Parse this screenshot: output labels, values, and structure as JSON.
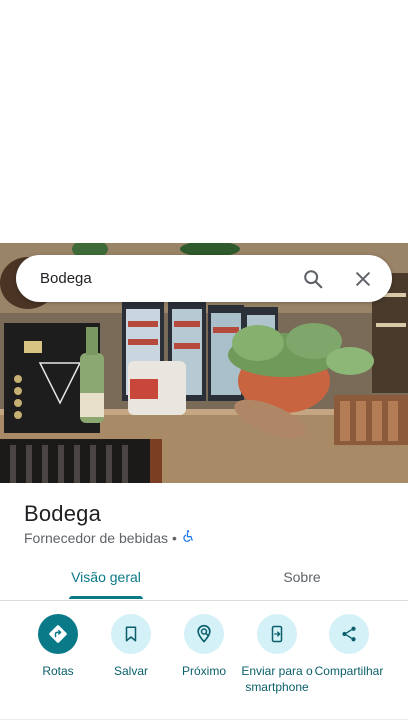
{
  "search": {
    "query": "Bodega"
  },
  "place": {
    "name": "Bodega",
    "category": "Fornecedor de bebidas",
    "separator": "•",
    "accessibility_icon": "wheelchair-icon"
  },
  "tabs": [
    {
      "label": "Visão geral",
      "selected": true
    },
    {
      "label": "Sobre",
      "selected": false
    }
  ],
  "actions": [
    {
      "label": "Rotas",
      "icon": "directions-icon"
    },
    {
      "label": "Salvar",
      "icon": "bookmark-icon"
    },
    {
      "label": "Próximo",
      "icon": "nearby-icon"
    },
    {
      "label": "Enviar para o smartphone",
      "icon": "send-to-phone-icon"
    },
    {
      "label": "Compartilhar",
      "icon": "share-icon"
    }
  ],
  "colors": {
    "accent": "#0b7a88",
    "action_bg": "#d4f1f8",
    "text_secondary": "#5f6368"
  }
}
